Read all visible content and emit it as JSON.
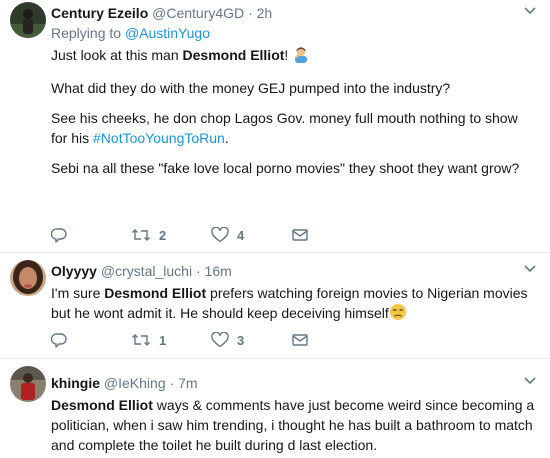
{
  "tweets": [
    {
      "name": "Century Ezeilo",
      "handle": "@Century4GD",
      "separator": "·",
      "time": "2h",
      "replying_prefix": "Replying to",
      "replying_to": "@AustinYugo",
      "line1_pre": "Just look at this man ",
      "line1_bold": "Desmond Elliot",
      "line1_post": "! ",
      "emoji1": "person-facepalming-emoji",
      "para2": "What did they do with the money GEJ pumped into the industry?",
      "para3_pre": "See his cheeks, he don chop Lagos Gov. money full mouth nothing to show for his ",
      "hashtag": "#NotTooYoungToRun",
      "para3_post": ".",
      "para4": "Sebi na all these \"fake love local porno movies\" they shoot they want grow?",
      "retweets": "2",
      "likes": "4"
    },
    {
      "name": "Olyyyy",
      "handle": "@crystal_luchi",
      "separator": "·",
      "time": "16m",
      "text_pre": "I'm sure ",
      "text_bold": "Desmond Elliot",
      "text_post": " prefers watching foreign movies to Nigerian movies but he wont admit it. He should keep deceiving himself",
      "emoji": "unamused-face-emoji",
      "retweets": "1",
      "likes": "3"
    },
    {
      "name": "khingie",
      "handle": "@IeKhing",
      "separator": "·",
      "time": "7m",
      "text_bold": "Desmond Elliot",
      "text_post": " ways & comments have just become weird since becoming a politician, when i saw him trending,  i thought he has built a bathroom to match and complete the toilet he built during d last election."
    }
  ],
  "colors": {
    "text": "#14171a",
    "muted": "#657786",
    "link": "#1b95e0",
    "divider": "#e6ecf0"
  }
}
